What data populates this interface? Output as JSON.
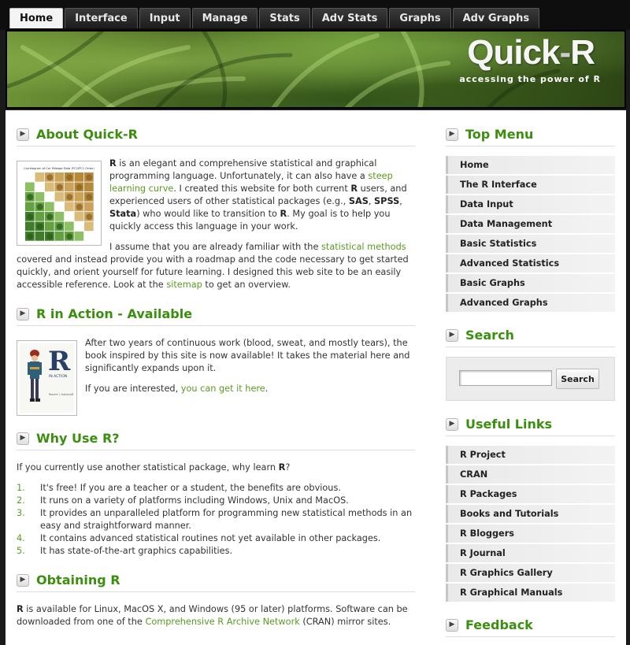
{
  "nav": {
    "tabs": [
      "Home",
      "Interface",
      "Input",
      "Manage",
      "Stats",
      "Adv Stats",
      "Graphs",
      "Adv Graphs"
    ],
    "active": "Home"
  },
  "banner": {
    "logo_left": "Quick",
    "logo_dash": "-",
    "logo_right": "R",
    "tagline": "accessing the power of R"
  },
  "main": {
    "about": {
      "title": "About Quick-R",
      "p1": [
        {
          "t": "R",
          "b": true
        },
        {
          "t": " is an elegant and comprehensive statistical and graphical programming language. Unfortunately, it can also have a "
        },
        {
          "t": "steep learning curve",
          "link": true
        },
        {
          "t": ". I created this website for both current "
        },
        {
          "t": "R",
          "b": true
        },
        {
          "t": " users, and experienced users of other statistical packages (e.g., "
        },
        {
          "t": "SAS",
          "b": true
        },
        {
          "t": ", "
        },
        {
          "t": "SPSS",
          "b": true
        },
        {
          "t": ", "
        },
        {
          "t": "Stata",
          "b": true
        },
        {
          "t": ") who would like to transition to "
        },
        {
          "t": "R",
          "b": true
        },
        {
          "t": ". My goal is to help you quickly access this language in your work."
        }
      ],
      "p2": [
        {
          "t": "I assume that you are already familiar with the "
        },
        {
          "t": "statistical methods",
          "link": true
        },
        {
          "t": " covered and instead provide you with a roadmap and the code necessary to get started quickly, and orient yourself for future learning. I designed this web site to be an easily accessible reference. Look at the "
        },
        {
          "t": "sitemap",
          "link": true
        },
        {
          "t": " to get an overview."
        }
      ],
      "thumb_title": "Correlogram of Car Mileage Data (PC2/PC1 Order)"
    },
    "action": {
      "title": "R in Action - Available",
      "p1": "After two years of continuous work (blood, sweat, and mostly tears), the book inspired by this site is now available! It takes the material here and significantly expands upon it.",
      "p2_pre": "If you are interested, ",
      "p2_link": "you can get it here",
      "p2_post": ".",
      "book_letter": "R",
      "book_subtitle": "IN ACTION",
      "book_author": "Robert I. Kabacoff"
    },
    "why": {
      "title": "Why Use R?",
      "intro_pre": "If you currently use another statistical package, why learn ",
      "intro_b": "R",
      "intro_post": "?",
      "items": [
        "It's free! If you are a teacher or a student, the benefits are obvious.",
        "It runs on a variety of platforms including Windows, Unix and MacOS.",
        "It provides an unparalleled platform for programming new statistical methods in an easy and straightforward manner.",
        "It contains advanced statistical routines not yet available in other packages.",
        "It has state-of-the-art graphics capabilities."
      ]
    },
    "obtaining": {
      "title": "Obtaining R",
      "p_b": "R",
      "p_mid": " is available for Linux, MacOS X, and Windows (95 or later) platforms. Software can be downloaded from one of the ",
      "p_link": "Comprehensive R Archive Network",
      "p_post": " (CRAN) mirror sites."
    }
  },
  "side": {
    "top_menu": {
      "title": "Top Menu",
      "items": [
        "Home",
        "The R Interface",
        "Data Input",
        "Data Management",
        "Basic Statistics",
        "Advanced Statistics",
        "Basic Graphs",
        "Advanced Graphs"
      ]
    },
    "search": {
      "title": "Search",
      "placeholder": "",
      "button": "Search"
    },
    "links": {
      "title": "Useful Links",
      "items": [
        "R Project",
        "CRAN",
        "R Packages",
        "Books and Tutorials",
        "R Bloggers",
        "R Journal",
        "R Graphics Gallery",
        "R Graphical Manuals"
      ]
    },
    "feedback": {
      "title": "Feedback"
    }
  },
  "colors": {
    "accent": "#3a8f0e",
    "link": "#5a9a22",
    "nav_bg": "#0e0e0e"
  }
}
